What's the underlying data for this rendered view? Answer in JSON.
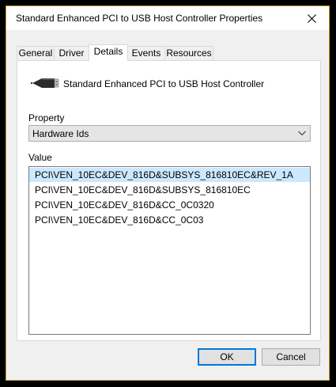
{
  "window": {
    "title": "Standard Enhanced PCI to USB Host Controller Properties",
    "frame_color": "#c9a227"
  },
  "tabs": [
    {
      "label": "General"
    },
    {
      "label": "Driver"
    },
    {
      "label": "Details",
      "active": true
    },
    {
      "label": "Events"
    },
    {
      "label": "Resources"
    }
  ],
  "device": {
    "icon": "usb-connector-icon",
    "name": "Standard Enhanced PCI to USB Host Controller"
  },
  "property": {
    "label": "Property",
    "selected": "Hardware Ids"
  },
  "value": {
    "label": "Value",
    "items": [
      "PCI\\VEN_10EC&DEV_816D&SUBSYS_816810EC&REV_1A",
      "PCI\\VEN_10EC&DEV_816D&SUBSYS_816810EC",
      "PCI\\VEN_10EC&DEV_816D&CC_0C0320",
      "PCI\\VEN_10EC&DEV_816D&CC_0C03"
    ],
    "selected_index": 0,
    "selection_color": "#cce8ff"
  },
  "buttons": {
    "ok": "OK",
    "cancel": "Cancel"
  }
}
